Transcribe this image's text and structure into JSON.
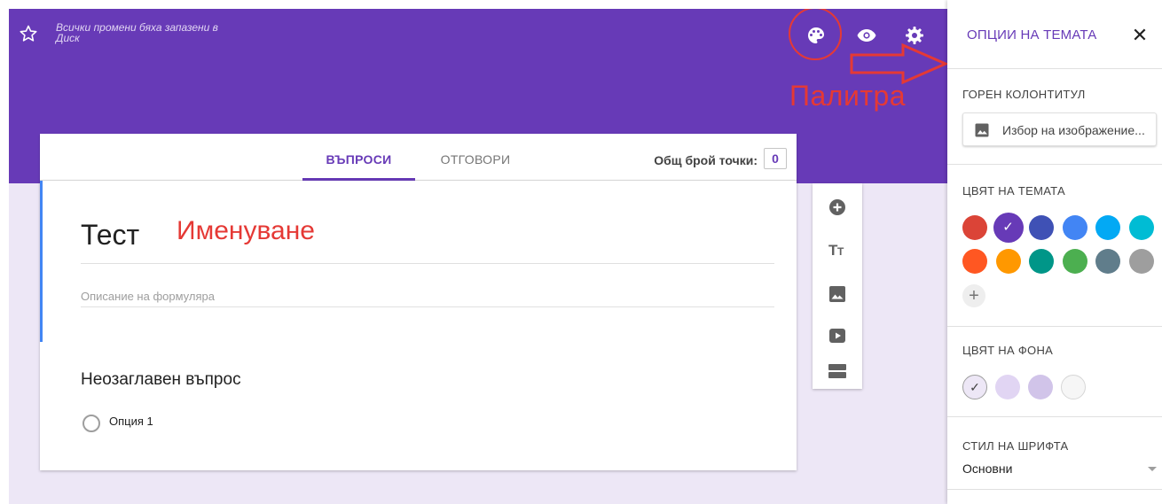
{
  "header": {
    "save_status": "Всички промени бяха запазени в Диск",
    "icons": [
      "star-icon",
      "palette-icon",
      "preview-eye-icon",
      "settings-gear-icon"
    ]
  },
  "annotations": {
    "palette_label": "Палитра",
    "naming_label": "Именуване",
    "color": "#e53935"
  },
  "tabs": {
    "questions": "ВЪПРОСИ",
    "responses": "ОТГОВОРИ",
    "active": "questions"
  },
  "points": {
    "label": "Общ брой точки:",
    "value": "0"
  },
  "form": {
    "title": "Тест",
    "description_placeholder": "Описание на формуляра",
    "question_title": "Неозаглавен въпрос",
    "option_label": "Опция 1"
  },
  "toolbar": {
    "tools": [
      "add-question-icon",
      "add-title-icon",
      "add-image-icon",
      "add-video-icon",
      "add-section-icon"
    ]
  },
  "theme_panel": {
    "title": "ОПЦИИ НА ТЕМАТА",
    "header_section_label": "ГОРЕН КОЛОНТИТУЛ",
    "choose_image_label": "Избор на изображение...",
    "theme_color_label": "ЦВЯТ НА ТЕМАТА",
    "theme_colors": [
      "#db4437",
      "#673ab7",
      "#3f51b5",
      "#4285f4",
      "#03a9f4",
      "#00bcd4",
      "#ff5722",
      "#ff9800",
      "#009688",
      "#4caf50",
      "#607d8b",
      "#9e9e9e"
    ],
    "selected_theme_color": "#673ab7",
    "background_color_label": "ЦВЯТ НА ФОНА",
    "background_colors": [
      "#ede7f6",
      "#e1d5f3",
      "#d1c4e9",
      "#f6f6f6"
    ],
    "selected_background_color": "#ede7f6",
    "font_style_label": "СТИЛ НА ШРИФТА",
    "font_style_value": "Основни"
  },
  "colors": {
    "accent": "#673ab7",
    "background": "#ede7f6",
    "focus": "#4285f4"
  }
}
